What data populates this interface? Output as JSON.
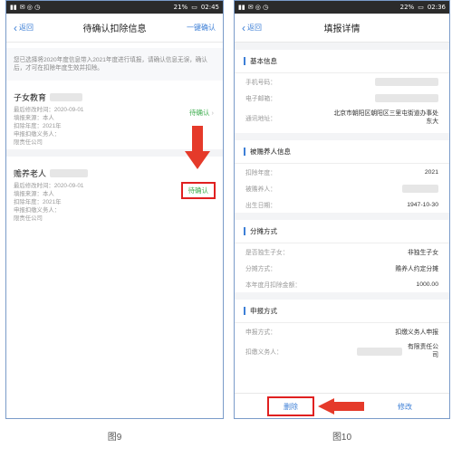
{
  "screen1": {
    "status": {
      "signal": "▮▮",
      "icons": "✉ ◎ ◷",
      "battery": "21%",
      "time": "02:45"
    },
    "nav": {
      "back": "返回",
      "title": "待确认扣除信息",
      "action": "一键确认"
    },
    "notice": "您已选择将2020年度信息带入2021年度进行填报，请确认信息无误，确认后，才可在扣除年度生效并扣除。",
    "cards": [
      {
        "title": "子女教育",
        "lines": [
          "最后修改时间：2020-09-01",
          "填报来源：本人",
          "扣除年度：2021年",
          "申报扣缴义务人：",
          "限责任公司"
        ],
        "status": "待确认"
      },
      {
        "title": "赡养老人",
        "lines": [
          "最后修改时间：2020-09-01",
          "填报来源：本人",
          "扣除年度：2021年",
          "申报扣缴义务人：",
          "限责任公司"
        ],
        "status": "待确认"
      }
    ],
    "caption": "图9"
  },
  "screen2": {
    "status": {
      "signal": "▮▮",
      "icons": "✉ ◎ ◷",
      "battery": "22%",
      "time": "02:36"
    },
    "nav": {
      "back": "返回",
      "title": "填报详情"
    },
    "sections": [
      {
        "title": "基本信息",
        "rows": [
          {
            "k": "手机号码：",
            "v": ""
          },
          {
            "k": "电子邮箱：",
            "v": ""
          },
          {
            "k": "通讯地址：",
            "v": "北京市朝阳区朝阳区三里屯街道办事处东大"
          }
        ]
      },
      {
        "title": "被赡养人信息",
        "rows": [
          {
            "k": "扣除年度：",
            "v": "2021"
          },
          {
            "k": "被赡养人：",
            "v": ""
          },
          {
            "k": "出生日期：",
            "v": "1947-10-30"
          }
        ]
      },
      {
        "title": "分摊方式",
        "rows": [
          {
            "k": "是否独生子女：",
            "v": "非独生子女"
          },
          {
            "k": "分摊方式：",
            "v": "赡养人约定分摊"
          },
          {
            "k": "本年度月扣除金额：",
            "v": "1000.00"
          }
        ]
      },
      {
        "title": "申报方式",
        "rows": [
          {
            "k": "申报方式：",
            "v": "扣缴义务人申报"
          },
          {
            "k": "扣缴义务人：",
            "v": "有限责任公司"
          }
        ]
      }
    ],
    "bottom": {
      "delete": "删除",
      "edit": "修改"
    },
    "caption": "图10"
  }
}
